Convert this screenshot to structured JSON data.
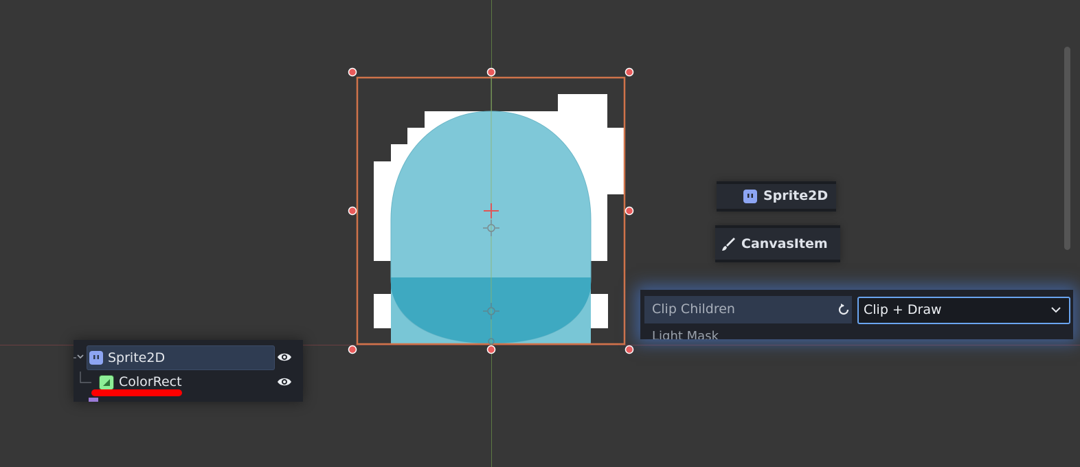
{
  "scene_tree": {
    "root": {
      "label": "Sprite2D",
      "icon": "sprite2d-icon",
      "visible": true,
      "selected": true
    },
    "child": {
      "label": "ColorRect",
      "icon": "colorrect-icon",
      "visible": true
    }
  },
  "inspector": {
    "node_class_header": "Sprite2D",
    "parent_class_header": "CanvasItem",
    "property": {
      "label": "Clip Children",
      "value": "Clip + Draw",
      "next_label": "Light Mask"
    }
  },
  "colors": {
    "background": "#373737",
    "selection_rect": "#d0734a",
    "handle": "#e95b5b",
    "sprite_white": "#ffffff",
    "color_rect": "#79c6d6",
    "clip_overlap": "#3ea9c1",
    "highlight": "#4782e6",
    "annotation_underline": "#ff0000",
    "sprite2d_icon": "#8da5f3",
    "colorrect_icon": "#8eef97"
  },
  "icons": {
    "revert": "revert-icon",
    "dropdown": "chevron-down-icon",
    "brush": "brush-icon",
    "visibility": "eye-icon",
    "pivot": "pivot-icon"
  }
}
